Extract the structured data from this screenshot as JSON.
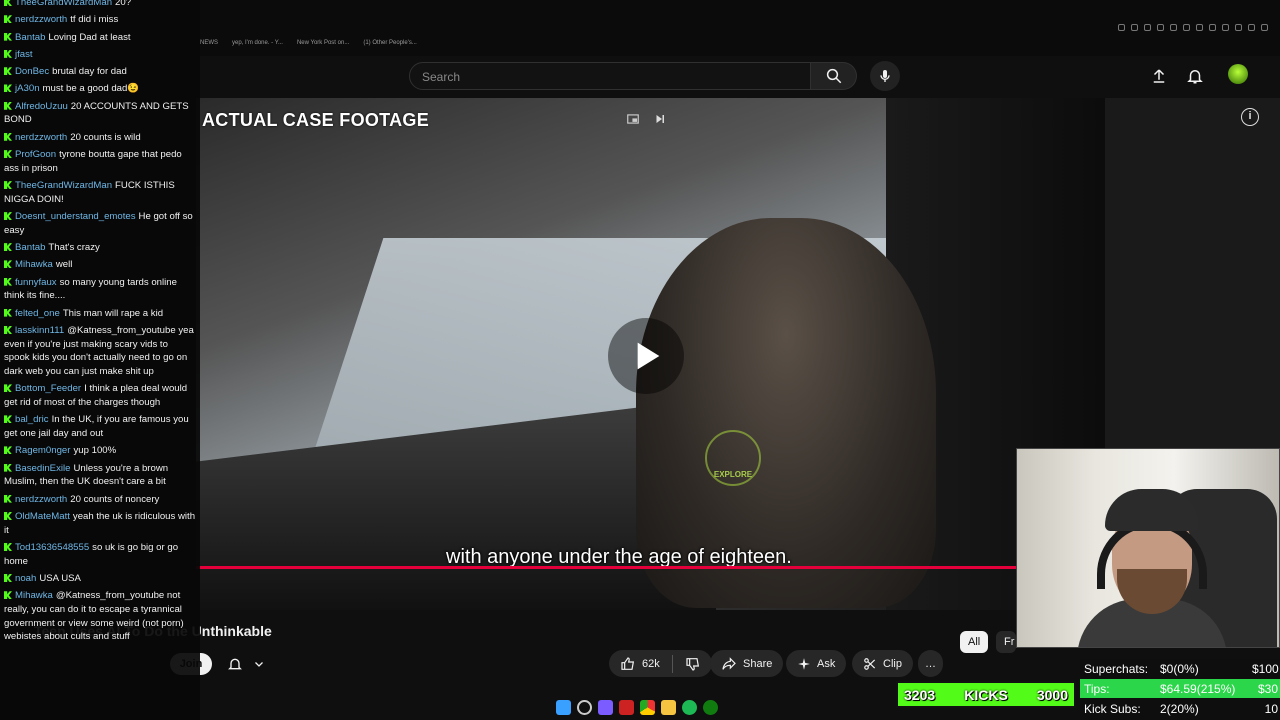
{
  "browser": {
    "tabs": [
      "NEWS",
      "yep, I'm done. - Y...",
      "New York Post on...",
      "(1) Other People's..."
    ]
  },
  "header": {
    "search_placeholder": "Search",
    "icons": [
      "search-icon",
      "mic-icon",
      "upload-icon",
      "bell-icon"
    ]
  },
  "video": {
    "overlay_title": "ACTUAL CASE FOOTAGE",
    "caption": "with anyone under the age of eighteen.",
    "watermark": "EXPLORE",
    "title": "Teen Uses AI To Do the Unthinkable",
    "progress_fraction": 0.9
  },
  "actions": {
    "join": "Join",
    "likes": "62k",
    "share": "Share",
    "ask": "Ask",
    "clip": "Clip",
    "more": "…"
  },
  "chips": [
    "All",
    "Fr"
  ],
  "chat": [
    {
      "user": "TheeGrandWizardMan",
      "text": "20?"
    },
    {
      "user": "nerdzzworth",
      "text": "tf did i miss"
    },
    {
      "user": "Bantab",
      "text": "Loving Dad at least"
    },
    {
      "user": "jfast",
      "text": ""
    },
    {
      "user": "DonBec",
      "text": "brutal day for dad"
    },
    {
      "user": "jA30n",
      "text": "must be a good dad😉"
    },
    {
      "user": "AlfredoUzuu",
      "text": "20 ACCOUNTS AND GETS BOND"
    },
    {
      "user": "nerdzzworth",
      "text": "20 counts is wild"
    },
    {
      "user": "ProfGoon",
      "text": "tyrone boutta gape that pedo ass in prison"
    },
    {
      "user": "TheeGrandWizardMan",
      "text": "FUCK ISTHIS NIGGA DOIN!"
    },
    {
      "user": "Doesnt_understand_emotes",
      "text": "He got off so easy"
    },
    {
      "user": "Bantab",
      "text": "That's crazy"
    },
    {
      "user": "Mihawka",
      "text": "well"
    },
    {
      "user": "funnyfaux",
      "text": "so many young tards online think its fine...."
    },
    {
      "user": "felted_one",
      "text": "This man will rape a kid"
    },
    {
      "user": "lasskinn111",
      "text": "@Katness_from_youtube yea even if you're just making scary vids to spook kids you don't actually need to go on dark web you can just make shit up"
    },
    {
      "user": "Bottom_Feeder",
      "text": "I think a plea deal would get rid of most of the charges though"
    },
    {
      "user": "bal_dric",
      "text": "In the UK, if you are famous you get one jail day and out"
    },
    {
      "user": "Ragem0nger",
      "text": "yup 100%"
    },
    {
      "user": "BasedinExile",
      "text": "Unless you're a brown Muslim, then the UK doesn't care a bit"
    },
    {
      "user": "nerdzzworth",
      "text": "20 counts of noncery"
    },
    {
      "user": "OldMateMatt",
      "text": "yeah the uk is ridiculous with it"
    },
    {
      "user": "Tod13636548555",
      "text": "so uk is go big or go home"
    },
    {
      "user": "noah",
      "text": "USA USA"
    },
    {
      "user": "Mihawka",
      "text": "@Katness_from_youtube not really, you can do it to escape a tyrannical government or view some weird (not porn) webistes about cults and stuff"
    }
  ],
  "stream": {
    "kicks_count": "3203",
    "kicks_label": "KICKS",
    "kicks_goal": "3000",
    "stats": [
      {
        "label": "Superchats:",
        "value": "$0(0%)",
        "goal": "$100",
        "color": "#ffffff",
        "bg": "#0e0e0e"
      },
      {
        "label": "Tips:",
        "value": "$64.59(215%)",
        "goal": "$30",
        "color": "#ffffff",
        "bg": "#2bd64a"
      },
      {
        "label": "Kick Subs:",
        "value": "2(20%)",
        "goal": "10",
        "color": "#ffffff",
        "bg": "#0e0e0e"
      }
    ]
  },
  "colors": {
    "accent_green": "#53fc18",
    "progress_red": "#e3003b",
    "chat_user": "#6fb7e6"
  }
}
